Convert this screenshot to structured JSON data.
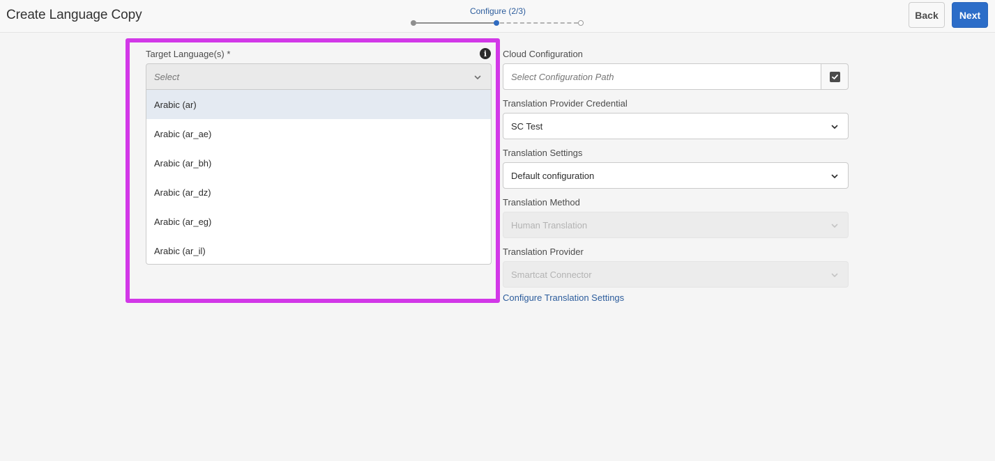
{
  "header": {
    "title": "Create Language Copy",
    "step_label": "Configure (2/3)",
    "back_label": "Back",
    "next_label": "Next"
  },
  "target_languages": {
    "label": "Target Language(s) *",
    "placeholder": "Select",
    "options": [
      "Arabic (ar)",
      "Arabic (ar_ae)",
      "Arabic (ar_bh)",
      "Arabic (ar_dz)",
      "Arabic (ar_eg)",
      "Arabic (ar_il)"
    ],
    "highlighted_option": "Arabic (ar)"
  },
  "cloud_configuration": {
    "label": "Cloud Configuration",
    "placeholder": "Select Configuration Path"
  },
  "provider_credential": {
    "label": "Translation Provider Credential",
    "value": "SC Test"
  },
  "translation_settings": {
    "label": "Translation Settings",
    "value": "Default configuration"
  },
  "translation_method": {
    "label": "Translation Method",
    "value": "Human Translation"
  },
  "translation_provider": {
    "label": "Translation Provider",
    "value": "Smartcat Connector"
  },
  "configure_link": "Configure Translation Settings",
  "colors": {
    "accent": "#2c6dc8",
    "highlight_border": "#d238e8",
    "link": "#2c5c9c"
  },
  "icons": {
    "info": "info-icon",
    "chevron": "chevron-down-icon",
    "checkbox": "checkbox-icon"
  }
}
